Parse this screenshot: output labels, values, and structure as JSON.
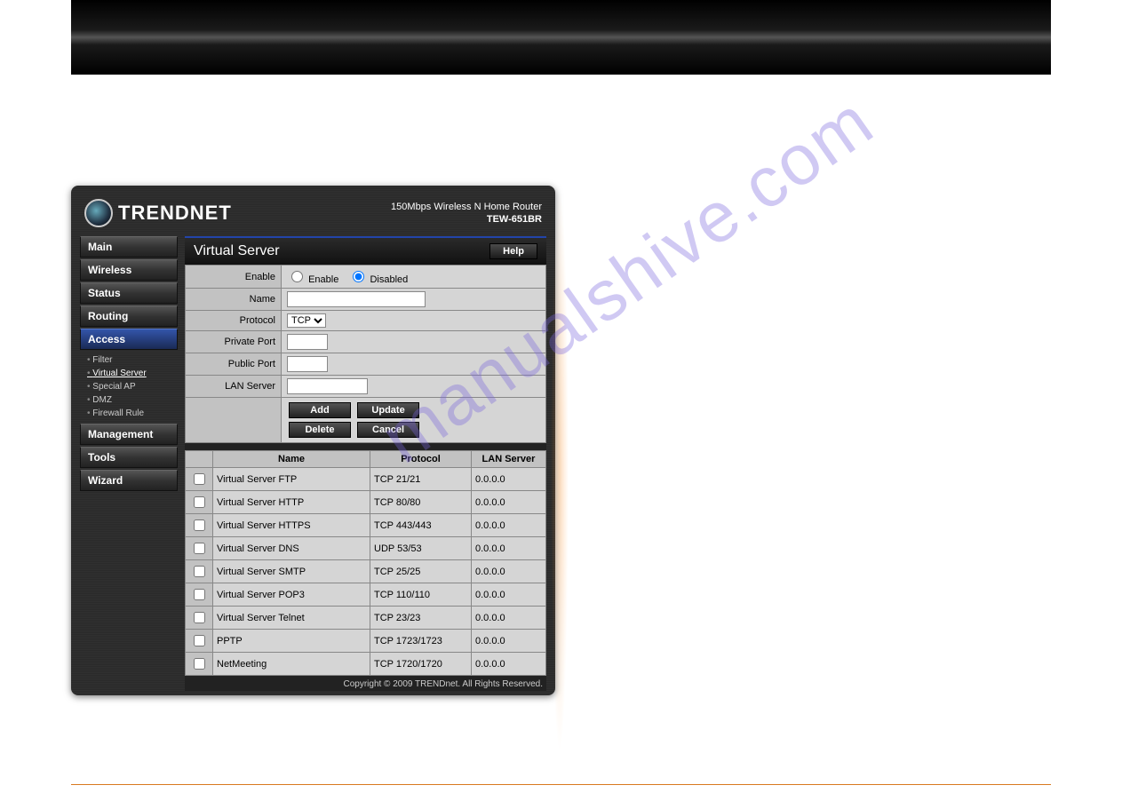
{
  "watermark": "manualshive.com",
  "header": {
    "brand": "TRENDNET",
    "subtitle": "150Mbps Wireless N Home Router",
    "model": "TEW-651BR"
  },
  "sidebar": {
    "items": [
      {
        "label": "Main"
      },
      {
        "label": "Wireless"
      },
      {
        "label": "Status"
      },
      {
        "label": "Routing"
      },
      {
        "label": "Access",
        "active": true,
        "sub": [
          {
            "label": "Filter"
          },
          {
            "label": "Virtual Server",
            "current": true
          },
          {
            "label": "Special AP"
          },
          {
            "label": "DMZ"
          },
          {
            "label": "Firewall Rule"
          }
        ]
      },
      {
        "label": "Management"
      },
      {
        "label": "Tools"
      },
      {
        "label": "Wizard"
      }
    ]
  },
  "panel": {
    "title": "Virtual Server",
    "help": "Help",
    "form": {
      "enable_label": "Enable",
      "enable_opt": "Enable",
      "disabled_opt": "Disabled",
      "name_label": "Name",
      "protocol_label": "Protocol",
      "protocol_value": "TCP",
      "private_port_label": "Private Port",
      "public_port_label": "Public Port",
      "lan_server_label": "LAN Server"
    },
    "buttons": {
      "add": "Add",
      "update": "Update",
      "delete": "Delete",
      "cancel": "Cancel"
    },
    "table": {
      "headers": {
        "name": "Name",
        "protocol": "Protocol",
        "lan": "LAN Server"
      },
      "rows": [
        {
          "name": "Virtual Server FTP",
          "protocol": "TCP 21/21",
          "lan": "0.0.0.0"
        },
        {
          "name": "Virtual Server HTTP",
          "protocol": "TCP 80/80",
          "lan": "0.0.0.0"
        },
        {
          "name": "Virtual Server HTTPS",
          "protocol": "TCP 443/443",
          "lan": "0.0.0.0"
        },
        {
          "name": "Virtual Server DNS",
          "protocol": "UDP 53/53",
          "lan": "0.0.0.0"
        },
        {
          "name": "Virtual Server SMTP",
          "protocol": "TCP 25/25",
          "lan": "0.0.0.0"
        },
        {
          "name": "Virtual Server POP3",
          "protocol": "TCP 110/110",
          "lan": "0.0.0.0"
        },
        {
          "name": "Virtual Server Telnet",
          "protocol": "TCP 23/23",
          "lan": "0.0.0.0"
        },
        {
          "name": "PPTP",
          "protocol": "TCP 1723/1723",
          "lan": "0.0.0.0"
        },
        {
          "name": "NetMeeting",
          "protocol": "TCP 1720/1720",
          "lan": "0.0.0.0"
        }
      ]
    }
  },
  "footer": "Copyright © 2009 TRENDnet. All Rights Reserved."
}
